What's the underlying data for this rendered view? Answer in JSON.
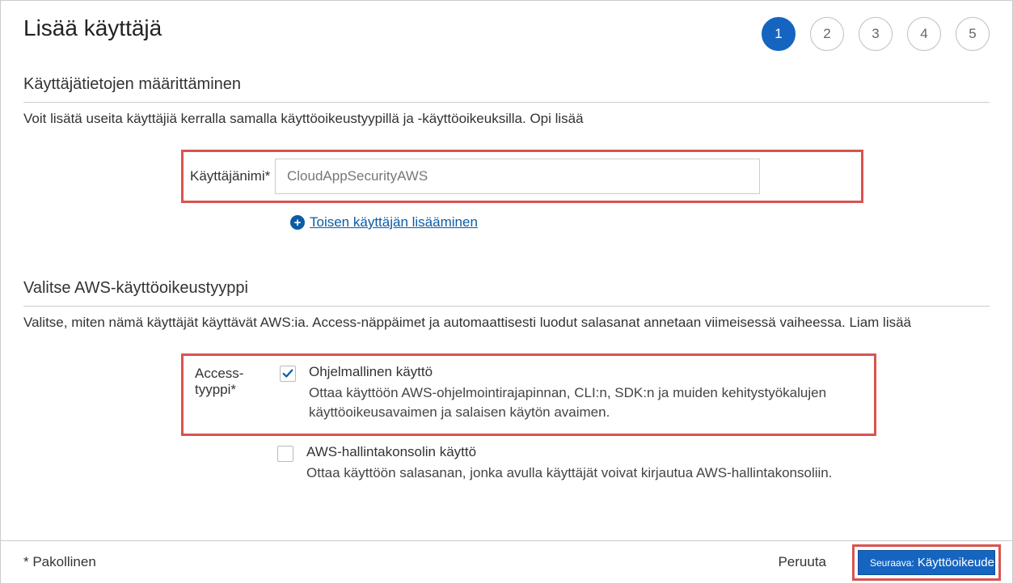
{
  "header": {
    "title": "Lisää käyttäjä",
    "steps": [
      "1",
      "2",
      "3",
      "4",
      "5"
    ],
    "active_step": 0
  },
  "section_user_details": {
    "title": "Käyttäjätietojen määrittäminen",
    "description": "Voit lisätä useita käyttäjiä kerralla samalla käyttöoikeustyypillä ja -käyttöoikeuksilla. Opi lisää",
    "username_label": "Käyttäjänimi*",
    "username_value": "CloudAppSecurityAWS",
    "add_another_label": "Toisen käyttäjän lisääminen"
  },
  "section_access_type": {
    "title": "Valitse AWS-käyttöoikeustyyppi",
    "description": "Valitse, miten nämä käyttäjät käyttävät AWS:ia. Access-näppäimet ja automaattisesti luodut salasanat annetaan viimeisessä vaiheessa. Liam lisää",
    "label": "Access-tyyppi*",
    "options": [
      {
        "checked": true,
        "title": "Ohjelmallinen käyttö",
        "desc": "Ottaa käyttöön AWS-ohjelmointirajapinnan, CLI:n, SDK:n ja muiden kehitystyökalujen käyttöoikeusavaimen ja salaisen käytön avaimen."
      },
      {
        "checked": false,
        "title": "AWS-hallintakonsolin käyttö",
        "desc": "Ottaa käyttöön salasanan, jonka avulla käyttäjät voivat kirjautua AWS-hallintakonsoliin."
      }
    ]
  },
  "footer": {
    "required_note": "* Pakollinen",
    "cancel_label": "Peruuta",
    "next_prefix": "Seuraava:",
    "next_label": "Käyttöoikeudet"
  }
}
